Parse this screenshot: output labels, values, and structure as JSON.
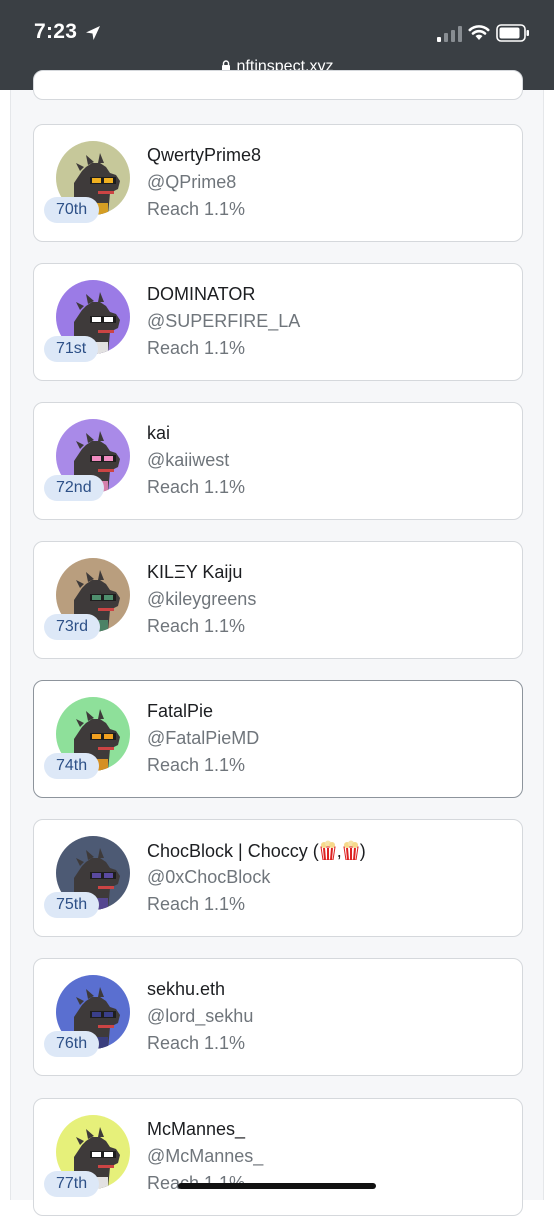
{
  "status_bar": {
    "time": "7:23",
    "url": "nftinspect.xyz"
  },
  "reach_label_prefix": "Reach",
  "entries": [
    {
      "rank": "70th",
      "name": "QwertyPrime8",
      "handle": "@QPrime8",
      "reach": "Reach 1.1%",
      "avatar_bg": "#c6c89a",
      "accent": "#f0b020"
    },
    {
      "rank": "71st",
      "name": "DOMINATOR",
      "handle": "@SUPERFIRE_LA",
      "reach": "Reach 1.1%",
      "avatar_bg": "#9b7be6",
      "accent": "#ffffff"
    },
    {
      "rank": "72nd",
      "name": "kai",
      "handle": "@kaiiwest",
      "reach": "Reach 1.1%",
      "avatar_bg": "#a98ae8",
      "accent": "#f08cc0"
    },
    {
      "rank": "73rd",
      "name": "KILΞY Kaiju",
      "handle": "@kileygreens",
      "reach": "Reach 1.1%",
      "avatar_bg": "#b99e7e",
      "accent": "#4f8f6e"
    },
    {
      "rank": "74th",
      "name": "FatalPie",
      "handle": "@FatalPieMD",
      "reach": "Reach 1.1%",
      "avatar_bg": "#8ee09a",
      "accent": "#f0a020"
    },
    {
      "rank": "75th",
      "name": "ChocBlock | Choccy (",
      "name_suffix": ")",
      "handle": "@0xChocBlock",
      "reach": "Reach 1.1%",
      "avatar_bg": "#4d5a74",
      "accent": "#5a4aa0"
    },
    {
      "rank": "76th",
      "name": "sekhu.eth",
      "handle": "@lord_sekhu",
      "reach": "Reach 1.1%",
      "avatar_bg": "#5a6fd0",
      "accent": "#3a3f8a"
    },
    {
      "rank": "77th",
      "name": "McMannes_",
      "handle": "@McMannes_",
      "reach": "Reach 1.1%",
      "avatar_bg": "#e6f07a",
      "accent": "#ffffff"
    }
  ],
  "colors": {
    "status_bar": "#3a3f44",
    "badge_bg": "#dde8f7",
    "badge_text": "#2d5087",
    "card_border": "#d5d8dc",
    "muted_text": "#6f757b"
  }
}
